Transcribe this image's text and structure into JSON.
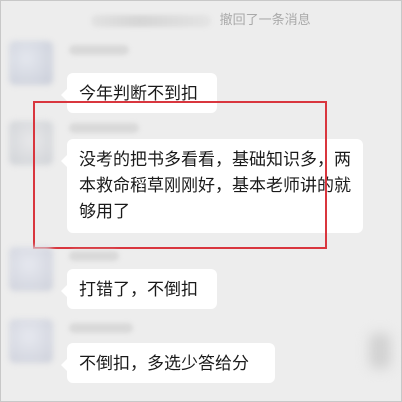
{
  "system_message": "撤回了一条消息",
  "messages": [
    {
      "text": "今年判断不到扣"
    },
    {
      "text": "没考的把书多看看，基础知识多，两本救命稻草刚刚好，基本老师讲的就够用了"
    },
    {
      "text": "打错了，不倒扣"
    },
    {
      "text": "不倒扣，多选少答给分"
    }
  ],
  "colors": {
    "background": "#ededed",
    "bubble": "#ffffff",
    "highlight_border": "#d9363e",
    "system_text": "#a9a9a9"
  }
}
